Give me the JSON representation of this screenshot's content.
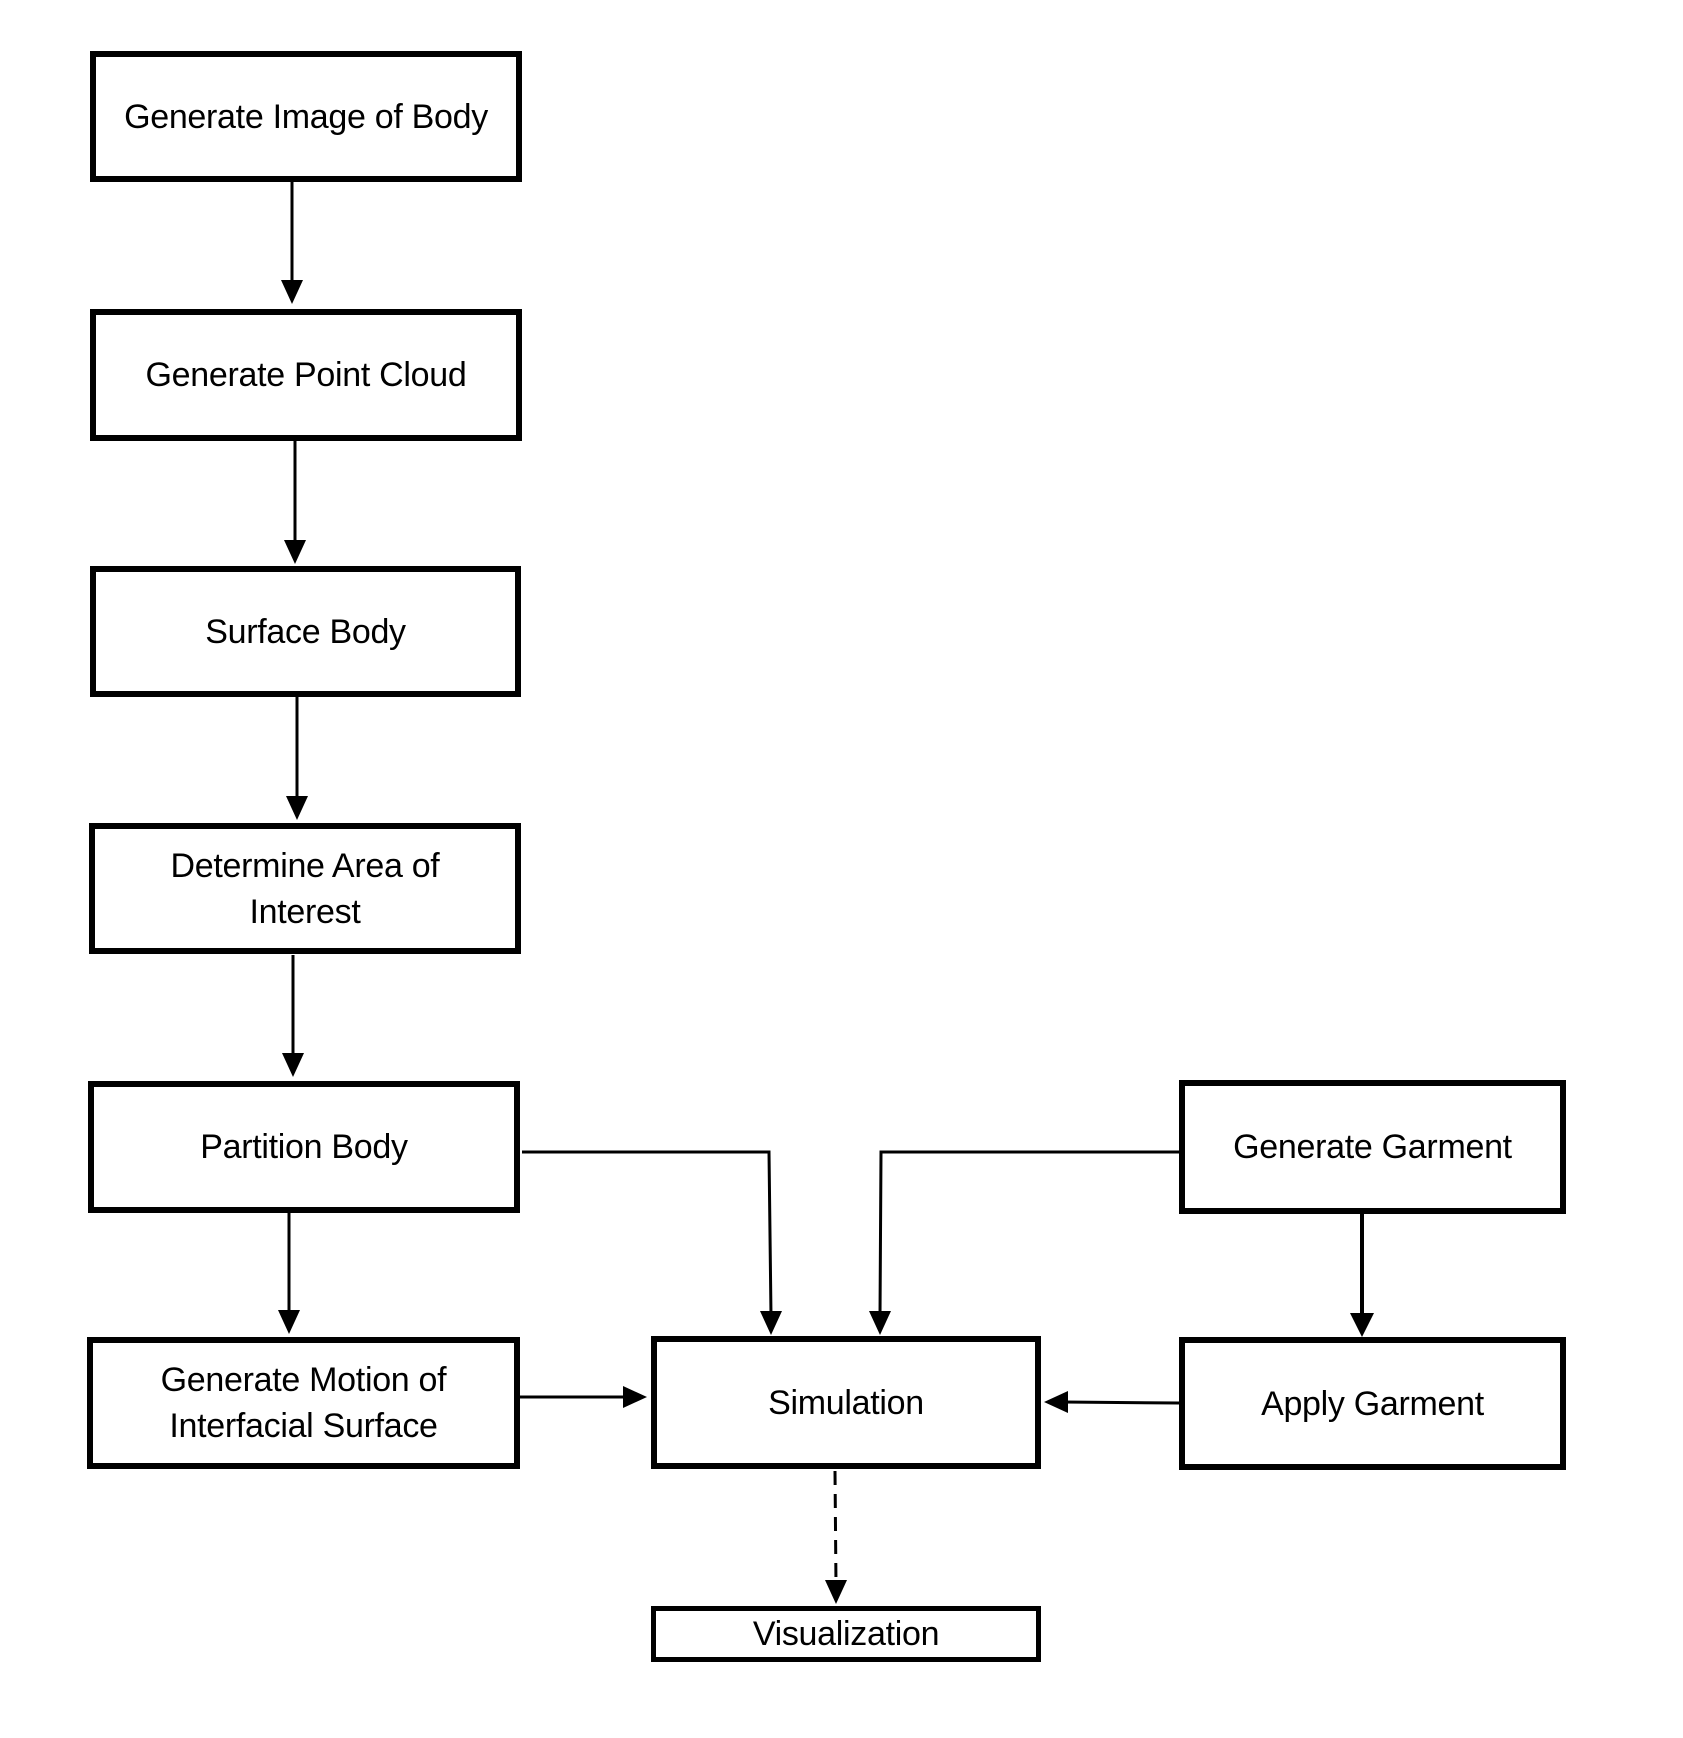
{
  "diagram": {
    "type": "flowchart",
    "nodes": {
      "generate_image_of_body": "Generate Image of Body",
      "generate_point_cloud": "Generate Point Cloud",
      "surface_body": "Surface Body",
      "determine_area_of_interest": "Determine Area of Interest",
      "partition_body": "Partition Body",
      "generate_motion_of_interfacial_surface": "Generate Motion of Interfacial Surface",
      "simulation": "Simulation",
      "generate_garment": "Generate Garment",
      "apply_garment": "Apply Garment",
      "visualization": "Visualization"
    },
    "edges": [
      {
        "from": "Generate Image of Body",
        "to": "Generate Point Cloud",
        "style": "solid"
      },
      {
        "from": "Generate Point Cloud",
        "to": "Surface Body",
        "style": "solid"
      },
      {
        "from": "Surface Body",
        "to": "Determine Area of Interest",
        "style": "solid"
      },
      {
        "from": "Determine Area of Interest",
        "to": "Partition Body",
        "style": "solid"
      },
      {
        "from": "Partition Body",
        "to": "Generate Motion of Interfacial Surface",
        "style": "solid"
      },
      {
        "from": "Partition Body",
        "to": "Simulation",
        "style": "solid"
      },
      {
        "from": "Generate Motion of Interfacial Surface",
        "to": "Simulation",
        "style": "solid"
      },
      {
        "from": "Generate Garment",
        "to": "Simulation",
        "style": "solid"
      },
      {
        "from": "Generate Garment",
        "to": "Apply Garment",
        "style": "solid"
      },
      {
        "from": "Apply Garment",
        "to": "Simulation",
        "style": "solid"
      },
      {
        "from": "Simulation",
        "to": "Visualization",
        "style": "dashed"
      }
    ]
  },
  "labels": {
    "box1": "Generate Image of Body",
    "box2": "Generate Point Cloud",
    "box3": "Surface Body",
    "box4_line1": "Determine Area of",
    "box4_line2": "Interest",
    "box5": "Partition Body",
    "box6_line1": "Generate Motion of",
    "box6_line2": "Interfacial Surface",
    "simulation": "Simulation",
    "generate_garment": "Generate Garment",
    "apply_garment": "Apply Garment",
    "visualization": "Visualization"
  }
}
